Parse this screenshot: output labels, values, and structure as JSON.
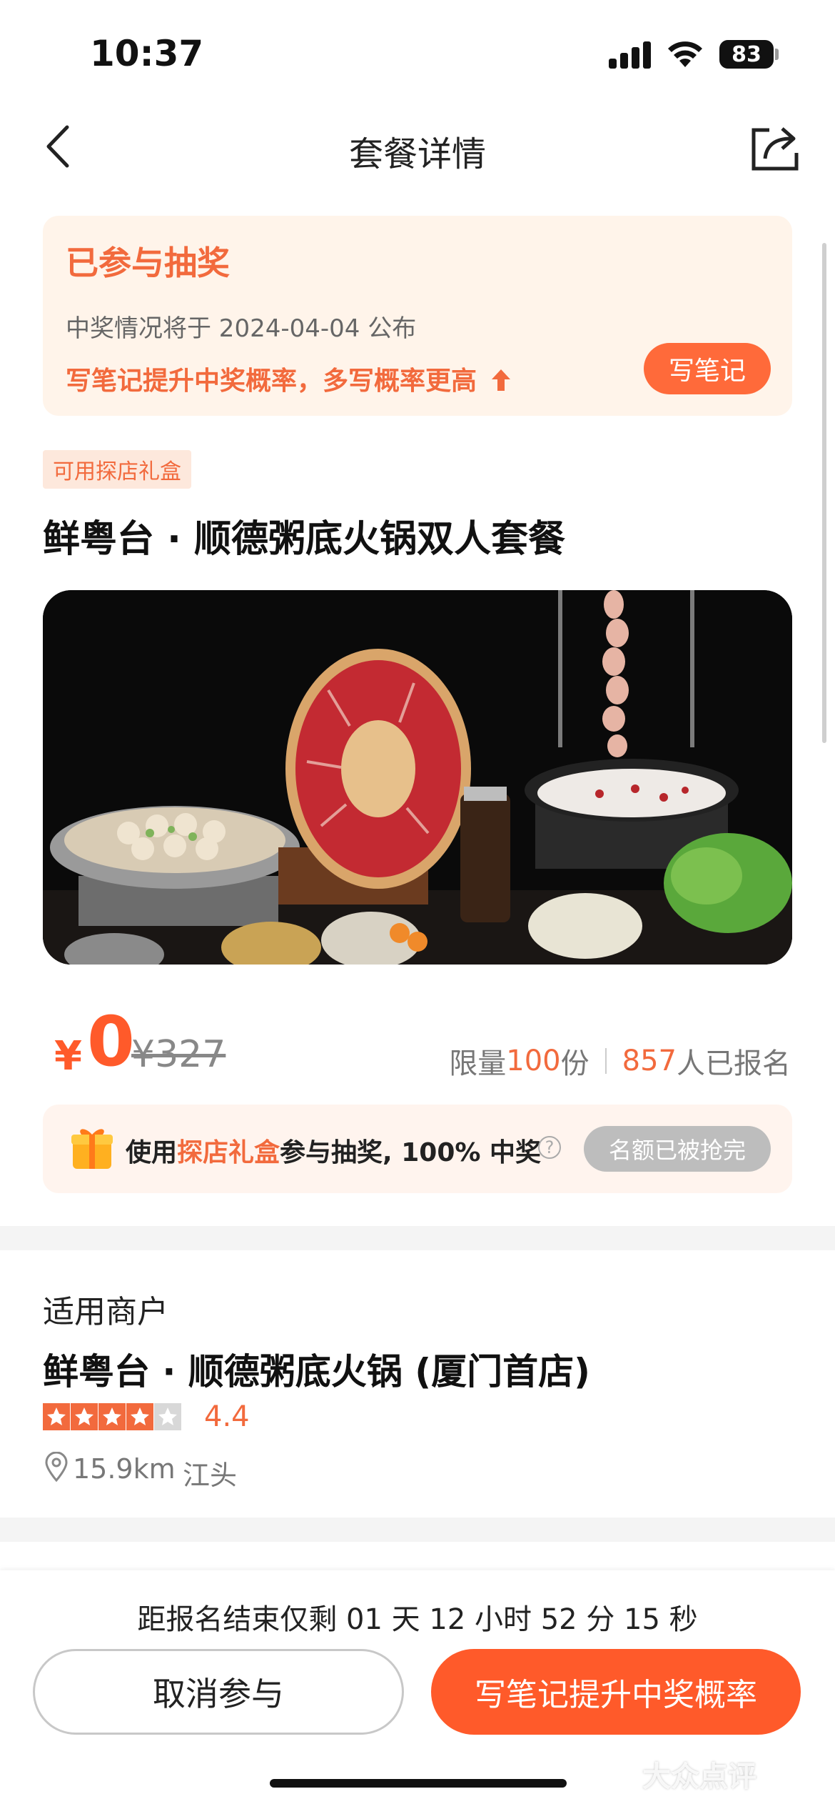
{
  "status_bar": {
    "time": "10:37",
    "battery": "83"
  },
  "nav": {
    "title": "套餐详情"
  },
  "lottery": {
    "title": "已参与抽奖",
    "announce": "中奖情况将于 2024-04-04 公布",
    "tip": "写笔记提升中奖概率，多写概率更高",
    "button": "写笔记"
  },
  "deal": {
    "tag": "可用探店礼盒",
    "title": "鲜粤台 · 顺德粥底火锅双人套餐"
  },
  "price": {
    "symbol": "¥",
    "current": "0",
    "original": "¥327",
    "quota_prefix": "限量",
    "quota_num": "100",
    "quota_suffix": "份",
    "signup_num": "857",
    "signup_suffix": "人已报名"
  },
  "gift_bar": {
    "prefix": "使用",
    "highlight": "探店礼盒",
    "suffix": "参与抽奖, 100% 中奖",
    "button": "名额已被抢完"
  },
  "merchant": {
    "label": "适用商户",
    "name": "鲜粤台 · 顺德粥底火锅 (厦门首店)",
    "stars": 4,
    "rating": "4.4",
    "distance": "15.9km",
    "area": "江头"
  },
  "bottom": {
    "countdown": "距报名结束仅剩 01 天 12 小时 52 分 15 秒",
    "cancel": "取消参与",
    "write": "写笔记提升中奖概率"
  },
  "watermark": "大众点评",
  "colors": {
    "accent": "#ff5a2a",
    "tip_bg": "#fff4ea"
  }
}
